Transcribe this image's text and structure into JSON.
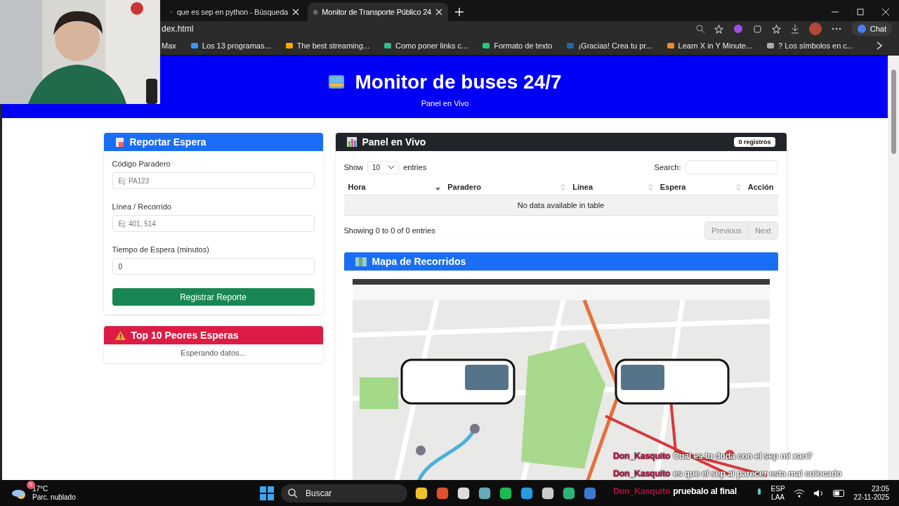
{
  "browser": {
    "tabs": [
      {
        "title": "que es sep en python - Búsqueda",
        "selected": false
      },
      {
        "title": "Monitor de Transporte Público 24",
        "selected": true
      }
    ],
    "address": "dex.html",
    "chat_button": "Chat",
    "bookmarks": [
      "Max",
      "Los 13 programas...",
      "The best streaming...",
      "Como poner links c...",
      "Formato de texto",
      "¡Gracias! Crea tu pr...",
      "Learn X in Y Minute...",
      "? Los símbolos en c..."
    ]
  },
  "header": {
    "title": "Monitor de buses 24/7",
    "subtitle": "Panel en Vivo"
  },
  "report_card": {
    "title": "Reportar Espera",
    "fields": [
      {
        "label": "Código Paradero",
        "placeholder": "Ej: PA123"
      },
      {
        "label": "Línea / Recorrido",
        "placeholder": "Ej: 401, 514"
      },
      {
        "label": "Tiempo de Espera (minutos)",
        "value": "0"
      }
    ],
    "submit": "Registrar Reporte"
  },
  "top_card": {
    "title": "Top 10 Peores Esperas",
    "message": "Esperando datos..."
  },
  "live_panel": {
    "title": "Panel en Vivo",
    "badge": "0 registros",
    "show_label": "Show",
    "page_length": "10",
    "entries_label": "entries",
    "search_label": "Search:",
    "columns": [
      {
        "label": "Hora",
        "sortable": true,
        "sorted": true
      },
      {
        "label": "Paradero",
        "sortable": true,
        "sorted": false
      },
      {
        "label": "Línea",
        "sortable": true,
        "sorted": false
      },
      {
        "label": "Espera",
        "sortable": true,
        "sorted": false
      },
      {
        "label": "Acción",
        "sortable": false,
        "sorted": false
      }
    ],
    "empty_message": "No data available in table",
    "info": "Showing 0 to 0 of 0 entries",
    "pagination": [
      {
        "label": "Previous",
        "disabled": true
      },
      {
        "label": "Next",
        "disabled": true
      }
    ]
  },
  "map_card": {
    "title": "Mapa de Recorridos"
  },
  "taskbar": {
    "weather": {
      "temperature": "17°C",
      "condition": "Parc. nublado",
      "badge": "5"
    },
    "search_placeholder": "Buscar",
    "language": "ESP",
    "layout": "LAA",
    "time": "23:05",
    "date": "22-11-2025"
  },
  "chat": [
    {
      "user": "Don_Kasquito",
      "message": "Cual es tu duda con el sep mi xan?"
    },
    {
      "user": "Don_Kasquito",
      "message": "es que el sep al parecer esta mal colocado"
    },
    {
      "user": "Don_Kasquito",
      "message": "pruebalo al final"
    }
  ]
}
